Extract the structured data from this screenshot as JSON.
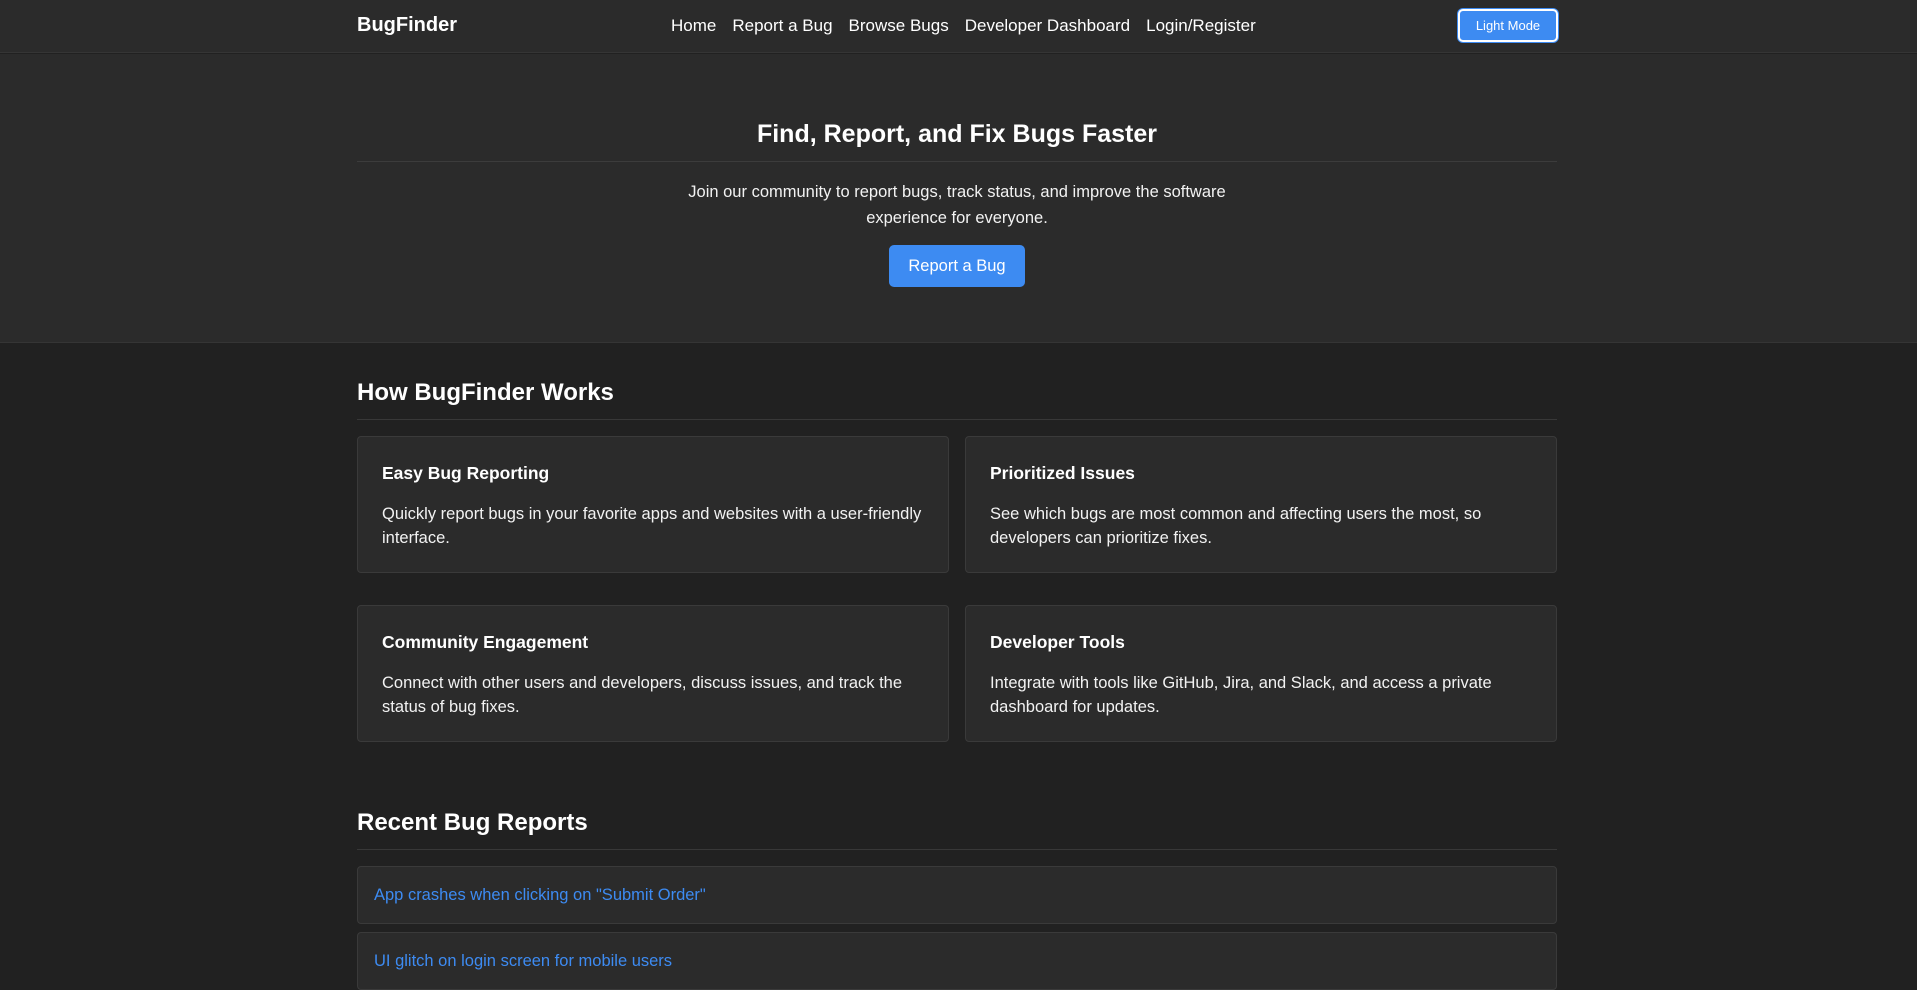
{
  "header": {
    "brand": "BugFinder",
    "nav": [
      "Home",
      "Report a Bug",
      "Browse Bugs",
      "Developer Dashboard",
      "Login/Register"
    ],
    "mode_button": "Light Mode"
  },
  "hero": {
    "title": "Find, Report, and Fix Bugs Faster",
    "text": "Join our community to report bugs, track status, and improve the software experience for everyone.",
    "button": "Report a Bug"
  },
  "how": {
    "title": "How BugFinder Works",
    "cards": [
      {
        "title": "Easy Bug Reporting",
        "desc": "Quickly report bugs in your favorite apps and websites with a user-friendly interface."
      },
      {
        "title": "Prioritized Issues",
        "desc": "See which bugs are most common and affecting users the most, so developers can prioritize fixes."
      },
      {
        "title": "Community Engagement",
        "desc": "Connect with other users and developers, discuss issues, and track the status of bug fixes."
      },
      {
        "title": "Developer Tools",
        "desc": "Integrate with tools like GitHub, Jira, and Slack, and access a private dashboard for updates."
      }
    ]
  },
  "recent": {
    "title": "Recent Bug Reports",
    "items": [
      "App crashes when clicking on \"Submit Order\"",
      "UI glitch on login screen for mobile users"
    ]
  },
  "colors": {
    "accent": "#3d8bf2",
    "background": "#212121",
    "surface": "#2b2b2b"
  }
}
